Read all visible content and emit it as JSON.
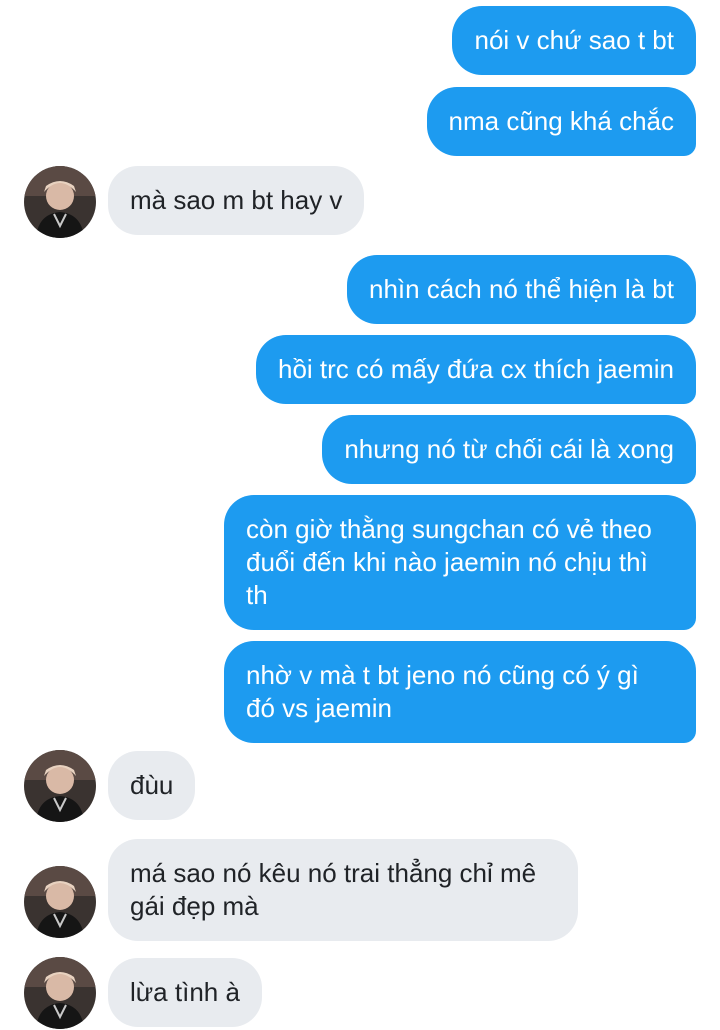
{
  "conversation": {
    "messages": [
      {
        "from": "me",
        "text": "nói v chứ sao t bt"
      },
      {
        "from": "me",
        "text": "nma cũng khá chắc"
      },
      {
        "from": "them",
        "text": "mà sao m bt hay v"
      },
      {
        "from": "me",
        "text": "nhìn cách nó thể hiện là bt"
      },
      {
        "from": "me",
        "text": "hồi trc có mấy đứa cx thích jaemin"
      },
      {
        "from": "me",
        "text": "nhưng nó từ chối cái là xong"
      },
      {
        "from": "me",
        "text": "còn giờ thằng sungchan có vẻ theo đuổi đến khi nào jaemin nó chịu thì th"
      },
      {
        "from": "me",
        "text": "nhờ v mà t bt jeno nó cũng có ý gì đó vs jaemin"
      },
      {
        "from": "them",
        "text": "đùu"
      },
      {
        "from": "them",
        "text": "má sao nó kêu nó trai thẳng chỉ mê gái đẹp mà"
      },
      {
        "from": "them",
        "text": "lừa tình à"
      }
    ]
  },
  "colors": {
    "sent_bubble": "#1d9bf0",
    "received_bubble": "#e8ebef",
    "sent_text": "#ffffff",
    "received_text": "#202327"
  },
  "icons": {
    "avatar": "contact-avatar-photo"
  }
}
